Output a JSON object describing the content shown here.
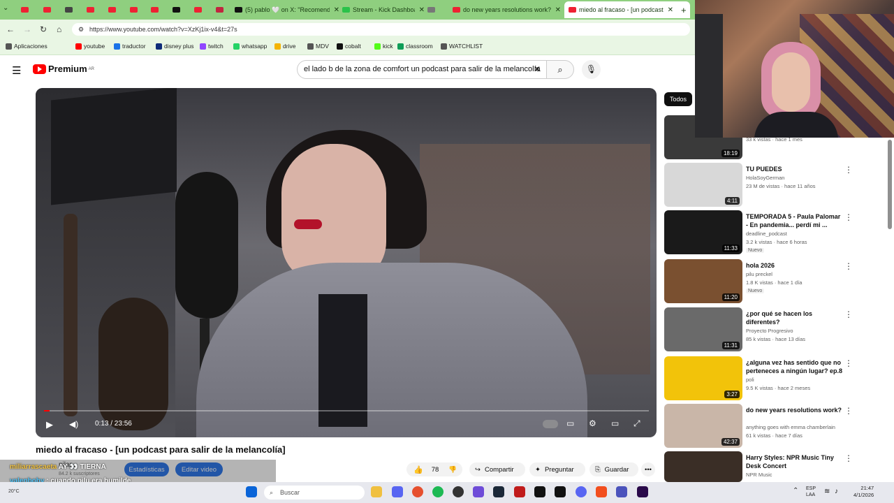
{
  "tabs": [
    {
      "label": "",
      "color": "#e23"
    },
    {
      "label": "",
      "color": "#e23"
    },
    {
      "label": "",
      "color": "#444"
    },
    {
      "label": "",
      "color": "#e23"
    },
    {
      "label": "",
      "color": "#e23"
    },
    {
      "label": "",
      "color": "#e23"
    },
    {
      "label": "",
      "color": "#e23"
    },
    {
      "label": "",
      "color": "#111"
    },
    {
      "label": "",
      "color": "#e23"
    },
    {
      "label": "",
      "color": "#c1263f"
    },
    {
      "label": "(5) pablo 🤍 on X: \"Recomend",
      "color": "#111"
    },
    {
      "label": "Stream - Kick Dashboard",
      "color": "#2ac24a"
    },
    {
      "label": "",
      "color": "#777"
    },
    {
      "label": "do new years resolutions work?",
      "color": "#e23"
    },
    {
      "label": "miedo al fracaso - [un podcast",
      "color": "#e23"
    }
  ],
  "new_tab": "+",
  "url": "https://www.youtube.com/watch?v=XzKj1ix-v4&t=27s",
  "bookmarks": [
    "Aplicaciones",
    "youtube",
    "traductor",
    "disney plus",
    "twitch",
    "whatsapp",
    "drive",
    "MDV",
    "cobalt",
    "kick",
    "classroom",
    "WATCHLIST"
  ],
  "yt": {
    "logo": "Premium",
    "logo_sup": "AR",
    "search_query": "el lado b de la zona de comfort  un podcast para salir de la melancolía"
  },
  "player": {
    "time": "0:13 / 23:56",
    "progress": 0.009
  },
  "video": {
    "title": "miedo al fracaso - [un podcast para salir de la melancolía]",
    "channel_partial": "pilar",
    "subs": "84.2 k suscriptores",
    "stats_label": "Estadísticas",
    "edit_label": "Editar video",
    "likes": "78",
    "share": "Compartir",
    "ask": "Preguntar",
    "save": "Guardar"
  },
  "sidebar": {
    "chip": "Todos",
    "items": [
      {
        "title": "",
        "channel": "",
        "meta": "33 k vistas · hace 1 mes",
        "duration": "18:19",
        "badge": ""
      },
      {
        "title": "TU PUEDES",
        "channel": "HolaSoyGerman",
        "meta": "23 M de vistas · hace 11 años",
        "duration": "4:11",
        "badge": ""
      },
      {
        "title": "TEMPORADA 5 - Paula Palomar - En pandemia... perdí mi ...",
        "channel": "deadline_podcast",
        "meta": "3.2 k vistas · hace 6 horas",
        "duration": "11:33",
        "badge": "Nuevo"
      },
      {
        "title": "hola 2026",
        "channel": "pilu preckel",
        "meta": "1.8 K vistas · hace 1 día",
        "duration": "11:20",
        "badge": "Nuevo"
      },
      {
        "title": "¿por qué se hacen los diferentes?",
        "channel": "Proyecto Progresivo",
        "meta": "85 k vistas · hace 13 días",
        "duration": "11:31",
        "badge": ""
      },
      {
        "title": "¿alguna vez has sentido que no perteneces a ningún lugar? ep.8",
        "channel": "poli",
        "meta": "9.5 K vistas · hace 2 meses",
        "duration": "3:27",
        "badge": ""
      },
      {
        "title": "do new years resolutions work?",
        "channel": "anything goes with emma chamberlain",
        "meta": "61 k vistas · hace 7 días",
        "duration": "42:37",
        "badge": ""
      },
      {
        "title": "Harry Styles: NPR Music Tiny Desk Concert",
        "channel": "NPR Music",
        "meta": "",
        "duration": "",
        "badge": ""
      }
    ]
  },
  "chat": [
    {
      "user": "miliarrascaeta",
      "msg": "AY 👀 TIERNA"
    },
    {
      "user": "valenboby",
      "msg": ": cuando pilu era humilde"
    },
    {
      "user": "miliarrascaeta",
      "msg": ": esto es constancia"
    }
  ],
  "weather": {
    "temp": "20°C"
  },
  "taskbar": {
    "search_placeholder": "Buscar",
    "lang": "ESP",
    "lang2": "LAA",
    "time": "21:47",
    "date": "4/1/2026"
  },
  "colors": {
    "tabbar": "#8fcf7f",
    "yt_red": "#ff0000",
    "accent_blue": "#1f6feb"
  }
}
